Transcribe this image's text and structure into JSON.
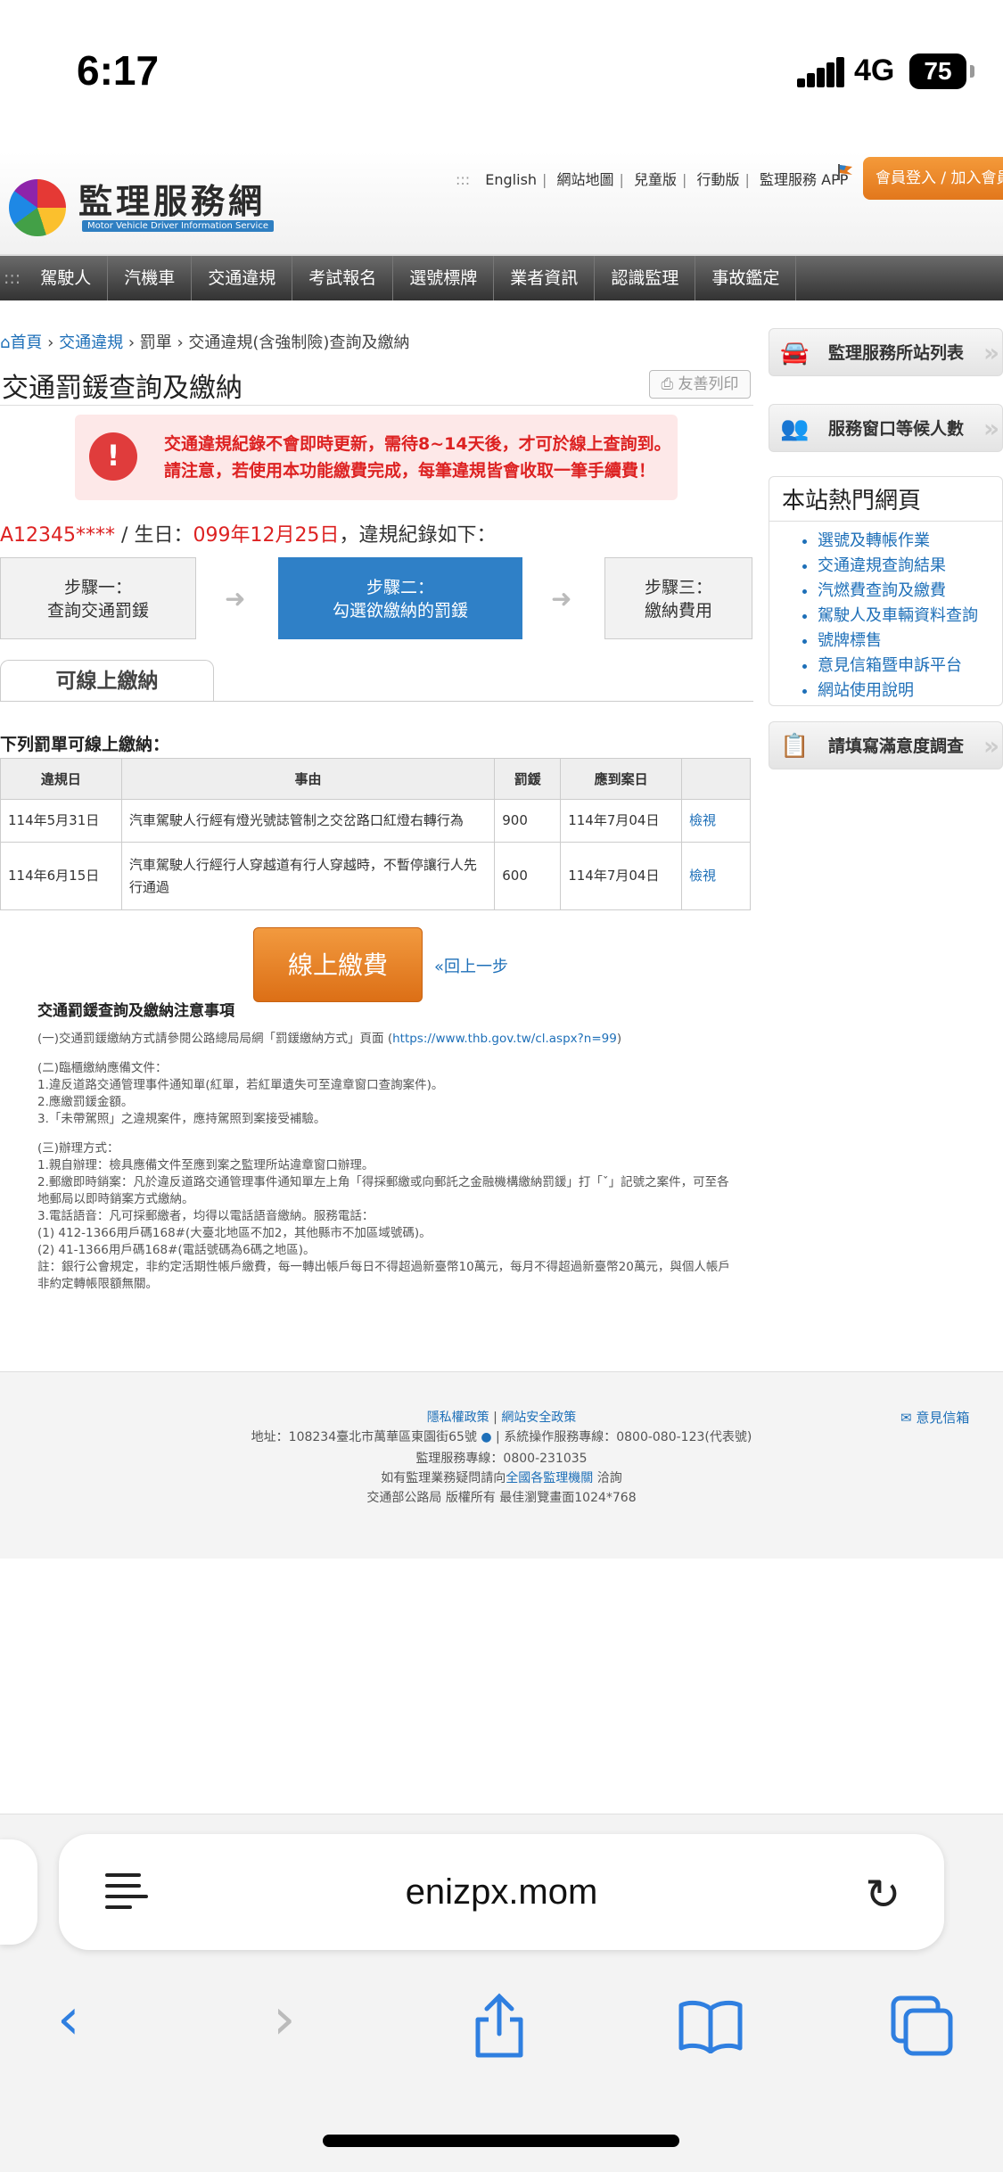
{
  "status_bar": {
    "time": "6:17",
    "network": "4G",
    "battery": "75"
  },
  "header": {
    "logo_title": "監理服務網",
    "logo_subtitle": "Motor Vehicle Driver Information Service",
    "top_links": [
      "English",
      "網站地圖",
      "兒童版",
      "行動版",
      "監理服務 APP"
    ],
    "login_label": "會員登入 / 加入會員"
  },
  "nav": {
    "items": [
      "駕駛人",
      "汽機車",
      "交通違規",
      "考試報名",
      "選號標牌",
      "業者資訊",
      "認識監理",
      "事故鑑定"
    ]
  },
  "breadcrumb": {
    "home": "首頁",
    "level1": "交通違規",
    "level2": "罰單",
    "level3": "交通違規(含強制險)查詢及繳納"
  },
  "page": {
    "title": "交通罰鍰查詢及繳納",
    "print_label": "友善列印",
    "alert_line1": "交通違規紀錄不會即時更新，需待8~14天後，才可於線上查詢到。",
    "alert_line2": "請注意，若使用本功能繳費完成，每筆違規皆會收取一筆手續費！",
    "id_value": "A12345****",
    "id_sep": " / 生日：",
    "birth_value": "099年12月25日",
    "id_suffix": "，違規紀錄如下：",
    "steps": [
      {
        "line1": "步驟一：",
        "line2": "查詢交通罰鍰"
      },
      {
        "line1": "步驟二：",
        "line2": "勾選欲繳納的罰鍰"
      },
      {
        "line1": "步驟三：",
        "line2": "繳納費用"
      }
    ],
    "tab_label": "可線上繳納",
    "list_title": "下列罰單可線上繳納：",
    "table": {
      "headers": [
        "違規日",
        "事由",
        "罰鍰",
        "應到案日",
        ""
      ],
      "rows": [
        {
          "date": "114年5月31日",
          "reason": "汽車駕駛人行經有燈光號誌管制之交岔路口紅燈右轉行為",
          "fine": "900",
          "due": "114年7月04日",
          "action": "檢視"
        },
        {
          "date": "114年6月15日",
          "reason": "汽車駕駛人行經行人穿越道有行人穿越時，不暫停讓行人先行通過",
          "fine": "600",
          "due": "114年7月04日",
          "action": "檢視"
        }
      ]
    },
    "pay_button": "線上繳費",
    "back_link": "«回上一步"
  },
  "notes": {
    "title": "交通罰鍰查詢及繳納注意事項",
    "p1_text": "(一)交通罰鍰繳納方式請參閱公路總局局網「罰鍰繳納方式」頁面 (",
    "p1_link": "https://www.thb.gov.tw/cl.aspx?n=99",
    "p1_end": ")",
    "p2": [
      "(二)臨櫃繳納應備文件：",
      "1.違反道路交通管理事件通知單(紅單，若紅單遺失可至違章窗口查詢案件)。",
      "2.應繳罰鍰金額。",
      "3.「未帶駕照」之違規案件，應持駕照到案接受補驗。"
    ],
    "p3": [
      "(三)辦理方式：",
      "1.親自辦理：檢具應備文件至應到案之監理所站違章窗口辦理。",
      "2.郵繳即時銷案：凡於違反道路交通管理事件通知單左上角「得採郵繳或向郵託之金融機構繳納罰鍰」打「ˇ」記號之案件，可至各地郵局以即時銷案方式繳納。",
      "3.電話語音：凡可採郵繳者，均得以電話語音繳納。服務電話：",
      "(1) 412-1366用戶碼168#(大臺北地區不加2，其他縣市不加區域號碼)。",
      "(2) 41-1366用戶碼168#(電話號碼為6碼之地區)。",
      "註：銀行公會規定，非約定活期性帳戶繳費，每一轉出帳戶每日不得超過新臺幣10萬元，每月不得超過新臺幣20萬元，與個人帳戶非約定轉帳限額無關。"
    ]
  },
  "sidebar": {
    "btn1": "監理服務所站列表",
    "btn2": "服務窗口等候人數",
    "hot_title": "本站熱門網頁",
    "hot_links": [
      "選號及轉帳作業",
      "交通違規查詢結果",
      "汽燃費查詢及繳費",
      "駕駛人及車輛資料查詢",
      "號牌標售",
      "意見信箱暨申訴平台",
      "網站使用說明"
    ],
    "btn3": "請填寫滿意度調查"
  },
  "footer": {
    "privacy": "隱私權政策",
    "security": "網站安全政策",
    "mailbox": "意見信箱",
    "address": "地址：108234臺北市萬華區東園街65號",
    "service_line": "系統操作服務專線：0800-080-123(代表號)",
    "hotline": "監理服務專線：0800-231035",
    "inquiry_pre": "如有監理業務疑問請向",
    "inquiry_link": "全國各監理機關",
    "inquiry_post": " 洽詢",
    "copyright": "交通部公路局 版權所有 最佳瀏覽畫面1024*768"
  },
  "browser": {
    "url": "enizpx.mom"
  }
}
